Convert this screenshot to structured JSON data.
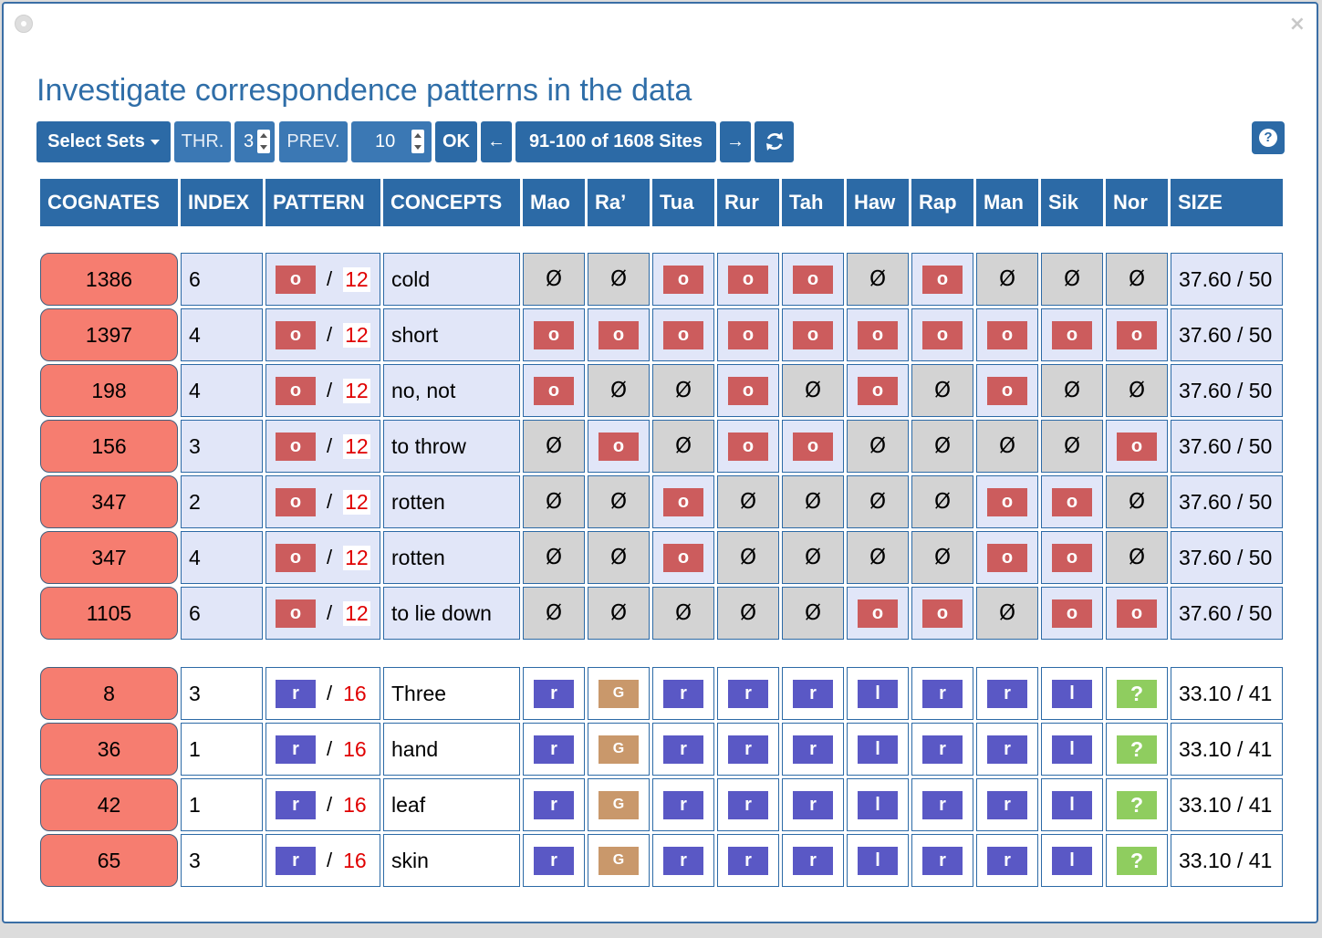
{
  "title": "Investigate correspondence patterns in the data",
  "toolbar": {
    "select_sets": "Select Sets",
    "thr_label": "THR.",
    "thr_value": "3",
    "prev_label": "PREV.",
    "prev_value": "10",
    "ok": "OK",
    "left_arrow": "←",
    "range": "91-100 of 1608 Sites",
    "right_arrow": "→",
    "refresh_icon": "refresh-icon",
    "help_icon": "question-icon",
    "help_glyph": "?"
  },
  "window": {
    "close_glyph": "×"
  },
  "columns": [
    "COGNATES",
    "INDEX",
    "PATTERN",
    "CONCEPTS",
    "Mao",
    "Ra’",
    "Tua",
    "Rur",
    "Tah",
    "Haw",
    "Rap",
    "Man",
    "Sik",
    "Nor",
    "SIZE"
  ],
  "colors": {
    "header_bg": "#2c6aa6",
    "cognate_bg": "#f67d70",
    "o_token": "#cc5c5d",
    "r_token": "#5a58c5",
    "G_token": "#c9986b",
    "q_token": "#8fcd5f",
    "missing_bg": "#d3d3d3",
    "group1_bg": "#e1e6f8"
  },
  "groups": [
    {
      "pattern_token": "o",
      "pattern_count": "12",
      "rows": [
        {
          "cognate": "1386",
          "index": "6",
          "concept": "cold",
          "size": "37.60 / 50",
          "cells": [
            "Ø",
            "Ø",
            "o",
            "o",
            "o",
            "Ø",
            "o",
            "Ø",
            "Ø",
            "Ø"
          ]
        },
        {
          "cognate": "1397",
          "index": "4",
          "concept": "short",
          "size": "37.60 / 50",
          "cells": [
            "o",
            "o",
            "o",
            "o",
            "o",
            "o",
            "o",
            "o",
            "o",
            "o"
          ]
        },
        {
          "cognate": "198",
          "index": "4",
          "concept": "no, not",
          "size": "37.60 / 50",
          "cells": [
            "o",
            "Ø",
            "Ø",
            "o",
            "Ø",
            "o",
            "Ø",
            "o",
            "Ø",
            "Ø"
          ]
        },
        {
          "cognate": "156",
          "index": "3",
          "concept": "to throw",
          "size": "37.60 / 50",
          "cells": [
            "Ø",
            "o",
            "Ø",
            "o",
            "o",
            "Ø",
            "Ø",
            "Ø",
            "Ø",
            "o"
          ]
        },
        {
          "cognate": "347",
          "index": "2",
          "concept": "rotten",
          "size": "37.60 / 50",
          "cells": [
            "Ø",
            "Ø",
            "o",
            "Ø",
            "Ø",
            "Ø",
            "Ø",
            "o",
            "o",
            "Ø"
          ]
        },
        {
          "cognate": "347",
          "index": "4",
          "concept": "rotten",
          "size": "37.60 / 50",
          "cells": [
            "Ø",
            "Ø",
            "o",
            "Ø",
            "Ø",
            "Ø",
            "Ø",
            "o",
            "o",
            "Ø"
          ]
        },
        {
          "cognate": "1105",
          "index": "6",
          "concept": "to lie down",
          "size": "37.60 / 50",
          "cells": [
            "Ø",
            "Ø",
            "Ø",
            "Ø",
            "Ø",
            "o",
            "o",
            "Ø",
            "o",
            "o"
          ]
        }
      ]
    },
    {
      "pattern_token": "r",
      "pattern_count": "16",
      "rows": [
        {
          "cognate": "8",
          "index": "3",
          "concept": "Three",
          "size": "33.10 / 41",
          "cells": [
            "r",
            "G",
            "r",
            "r",
            "r",
            "l",
            "r",
            "r",
            "l",
            "?"
          ]
        },
        {
          "cognate": "36",
          "index": "1",
          "concept": "hand",
          "size": "33.10 / 41",
          "cells": [
            "r",
            "G",
            "r",
            "r",
            "r",
            "l",
            "r",
            "r",
            "l",
            "?"
          ]
        },
        {
          "cognate": "42",
          "index": "1",
          "concept": "leaf",
          "size": "33.10 / 41",
          "cells": [
            "r",
            "G",
            "r",
            "r",
            "r",
            "l",
            "r",
            "r",
            "l",
            "?"
          ]
        },
        {
          "cognate": "65",
          "index": "3",
          "concept": "skin",
          "size": "33.10 / 41",
          "cells": [
            "r",
            "G",
            "r",
            "r",
            "r",
            "l",
            "r",
            "r",
            "l",
            "?"
          ]
        }
      ]
    }
  ]
}
